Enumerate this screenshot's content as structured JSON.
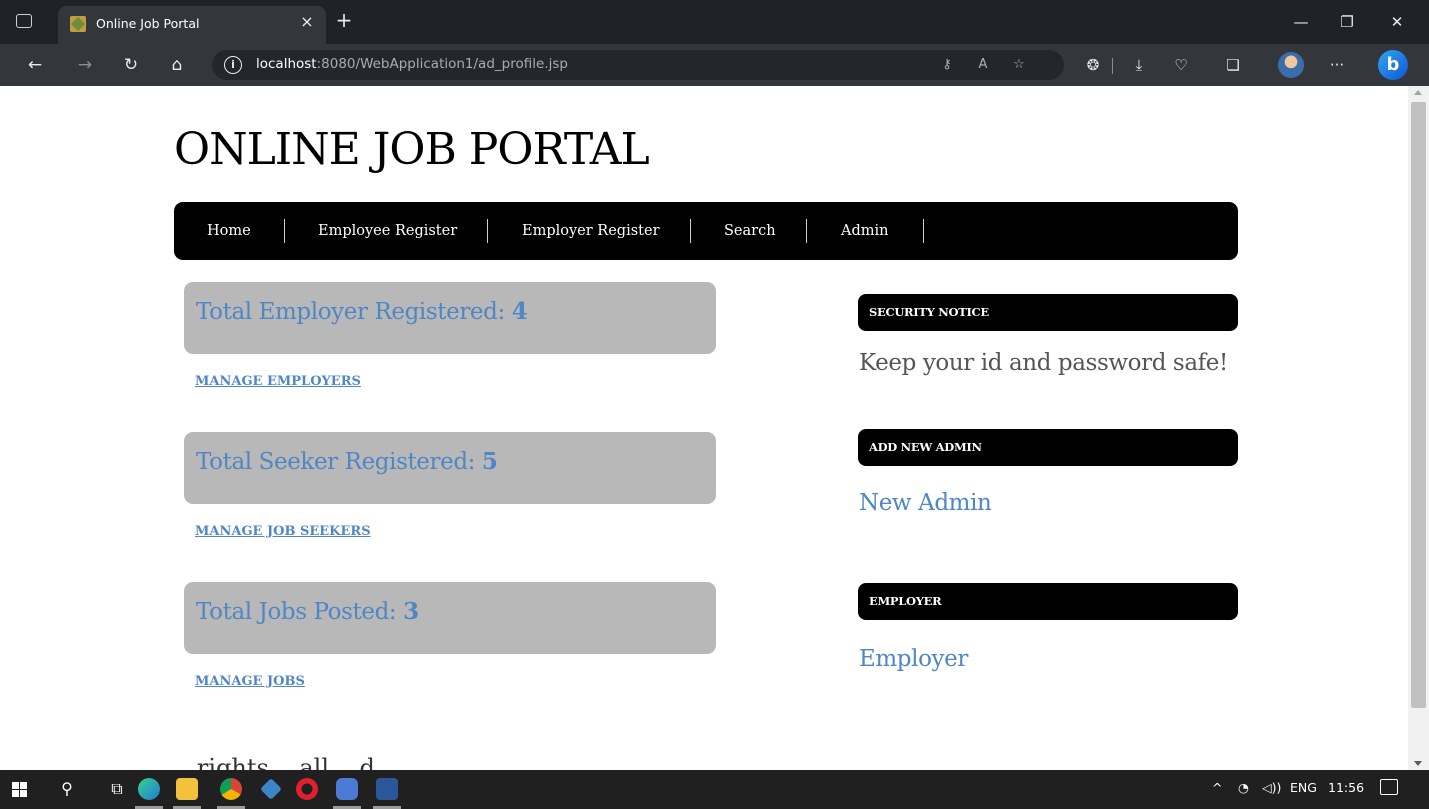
{
  "browser": {
    "tab_title": "Online Job Portal",
    "tab_close": "×",
    "new_tab": "+",
    "url_host": "localhost",
    "url_path": ":8080/WebApplication1/ad_profile.jsp",
    "window_controls": {
      "minimize": "—",
      "restore": "❐",
      "close": "✕"
    },
    "icons": [
      "back-icon",
      "forward-icon",
      "refresh-icon",
      "home-icon",
      "info-icon",
      "key-icon",
      "read-aloud-icon",
      "favorite-add-icon",
      "extensions-icon",
      "downloads-icon",
      "browser-essentials-icon",
      "collections-icon",
      "profile-avatar",
      "more-icon",
      "bing-copilot-icon"
    ]
  },
  "page": {
    "site_title": "ONLINE JOB PORTAL",
    "nav": {
      "items": [
        {
          "label": "Home"
        },
        {
          "label": "Employee Register"
        },
        {
          "label": "Employer Register"
        },
        {
          "label": "Search"
        },
        {
          "label": "Admin"
        }
      ]
    },
    "stats": [
      {
        "label": "Total Employer Registered: ",
        "value": "4",
        "link": "MANAGE EMPLOYERS"
      },
      {
        "label": "Total Seeker Registered: ",
        "value": "5",
        "link": "MANAGE JOB SEEKERS"
      },
      {
        "label": "Total Jobs Posted: ",
        "value": "3",
        "link": "MANAGE JOBS"
      }
    ],
    "sidebar": {
      "security_notice": {
        "heading": "SECURITY NOTICE",
        "text": "Keep your id and password safe!"
      },
      "add_admin": {
        "heading": "ADD NEW ADMIN",
        "link": "New Admin"
      },
      "employer": {
        "heading": "EMPLOYER",
        "link": "Employer"
      }
    },
    "footer_partial": "...rights ...all ...d"
  },
  "taskbar": {
    "tray": {
      "language": "ENG",
      "time": "11:56",
      "chevron": "^"
    }
  },
  "colors": {
    "link_blue": "#4f86c6",
    "stat_box_gray": "#b8b8b8",
    "menu_black": "#000000",
    "chrome_dark": "#1f2328"
  }
}
